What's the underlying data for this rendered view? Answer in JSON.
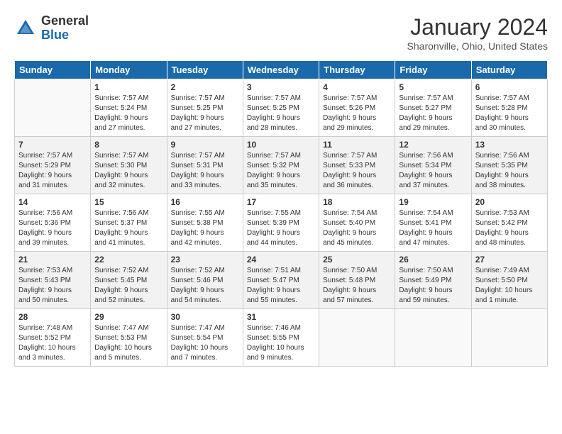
{
  "header": {
    "logo_general": "General",
    "logo_blue": "Blue",
    "month_title": "January 2024",
    "location": "Sharonville, Ohio, United States"
  },
  "weekdays": [
    "Sunday",
    "Monday",
    "Tuesday",
    "Wednesday",
    "Thursday",
    "Friday",
    "Saturday"
  ],
  "weeks": [
    [
      {
        "day": "",
        "info": ""
      },
      {
        "day": "1",
        "info": "Sunrise: 7:57 AM\nSunset: 5:24 PM\nDaylight: 9 hours\nand 27 minutes."
      },
      {
        "day": "2",
        "info": "Sunrise: 7:57 AM\nSunset: 5:25 PM\nDaylight: 9 hours\nand 27 minutes."
      },
      {
        "day": "3",
        "info": "Sunrise: 7:57 AM\nSunset: 5:25 PM\nDaylight: 9 hours\nand 28 minutes."
      },
      {
        "day": "4",
        "info": "Sunrise: 7:57 AM\nSunset: 5:26 PM\nDaylight: 9 hours\nand 29 minutes."
      },
      {
        "day": "5",
        "info": "Sunrise: 7:57 AM\nSunset: 5:27 PM\nDaylight: 9 hours\nand 29 minutes."
      },
      {
        "day": "6",
        "info": "Sunrise: 7:57 AM\nSunset: 5:28 PM\nDaylight: 9 hours\nand 30 minutes."
      }
    ],
    [
      {
        "day": "7",
        "info": "Sunrise: 7:57 AM\nSunset: 5:29 PM\nDaylight: 9 hours\nand 31 minutes."
      },
      {
        "day": "8",
        "info": "Sunrise: 7:57 AM\nSunset: 5:30 PM\nDaylight: 9 hours\nand 32 minutes."
      },
      {
        "day": "9",
        "info": "Sunrise: 7:57 AM\nSunset: 5:31 PM\nDaylight: 9 hours\nand 33 minutes."
      },
      {
        "day": "10",
        "info": "Sunrise: 7:57 AM\nSunset: 5:32 PM\nDaylight: 9 hours\nand 35 minutes."
      },
      {
        "day": "11",
        "info": "Sunrise: 7:57 AM\nSunset: 5:33 PM\nDaylight: 9 hours\nand 36 minutes."
      },
      {
        "day": "12",
        "info": "Sunrise: 7:56 AM\nSunset: 5:34 PM\nDaylight: 9 hours\nand 37 minutes."
      },
      {
        "day": "13",
        "info": "Sunrise: 7:56 AM\nSunset: 5:35 PM\nDaylight: 9 hours\nand 38 minutes."
      }
    ],
    [
      {
        "day": "14",
        "info": "Sunrise: 7:56 AM\nSunset: 5:36 PM\nDaylight: 9 hours\nand 39 minutes."
      },
      {
        "day": "15",
        "info": "Sunrise: 7:56 AM\nSunset: 5:37 PM\nDaylight: 9 hours\nand 41 minutes."
      },
      {
        "day": "16",
        "info": "Sunrise: 7:55 AM\nSunset: 5:38 PM\nDaylight: 9 hours\nand 42 minutes."
      },
      {
        "day": "17",
        "info": "Sunrise: 7:55 AM\nSunset: 5:39 PM\nDaylight: 9 hours\nand 44 minutes."
      },
      {
        "day": "18",
        "info": "Sunrise: 7:54 AM\nSunset: 5:40 PM\nDaylight: 9 hours\nand 45 minutes."
      },
      {
        "day": "19",
        "info": "Sunrise: 7:54 AM\nSunset: 5:41 PM\nDaylight: 9 hours\nand 47 minutes."
      },
      {
        "day": "20",
        "info": "Sunrise: 7:53 AM\nSunset: 5:42 PM\nDaylight: 9 hours\nand 48 minutes."
      }
    ],
    [
      {
        "day": "21",
        "info": "Sunrise: 7:53 AM\nSunset: 5:43 PM\nDaylight: 9 hours\nand 50 minutes."
      },
      {
        "day": "22",
        "info": "Sunrise: 7:52 AM\nSunset: 5:45 PM\nDaylight: 9 hours\nand 52 minutes."
      },
      {
        "day": "23",
        "info": "Sunrise: 7:52 AM\nSunset: 5:46 PM\nDaylight: 9 hours\nand 54 minutes."
      },
      {
        "day": "24",
        "info": "Sunrise: 7:51 AM\nSunset: 5:47 PM\nDaylight: 9 hours\nand 55 minutes."
      },
      {
        "day": "25",
        "info": "Sunrise: 7:50 AM\nSunset: 5:48 PM\nDaylight: 9 hours\nand 57 minutes."
      },
      {
        "day": "26",
        "info": "Sunrise: 7:50 AM\nSunset: 5:49 PM\nDaylight: 9 hours\nand 59 minutes."
      },
      {
        "day": "27",
        "info": "Sunrise: 7:49 AM\nSunset: 5:50 PM\nDaylight: 10 hours\nand 1 minute."
      }
    ],
    [
      {
        "day": "28",
        "info": "Sunrise: 7:48 AM\nSunset: 5:52 PM\nDaylight: 10 hours\nand 3 minutes."
      },
      {
        "day": "29",
        "info": "Sunrise: 7:47 AM\nSunset: 5:53 PM\nDaylight: 10 hours\nand 5 minutes."
      },
      {
        "day": "30",
        "info": "Sunrise: 7:47 AM\nSunset: 5:54 PM\nDaylight: 10 hours\nand 7 minutes."
      },
      {
        "day": "31",
        "info": "Sunrise: 7:46 AM\nSunset: 5:55 PM\nDaylight: 10 hours\nand 9 minutes."
      },
      {
        "day": "",
        "info": ""
      },
      {
        "day": "",
        "info": ""
      },
      {
        "day": "",
        "info": ""
      }
    ]
  ]
}
